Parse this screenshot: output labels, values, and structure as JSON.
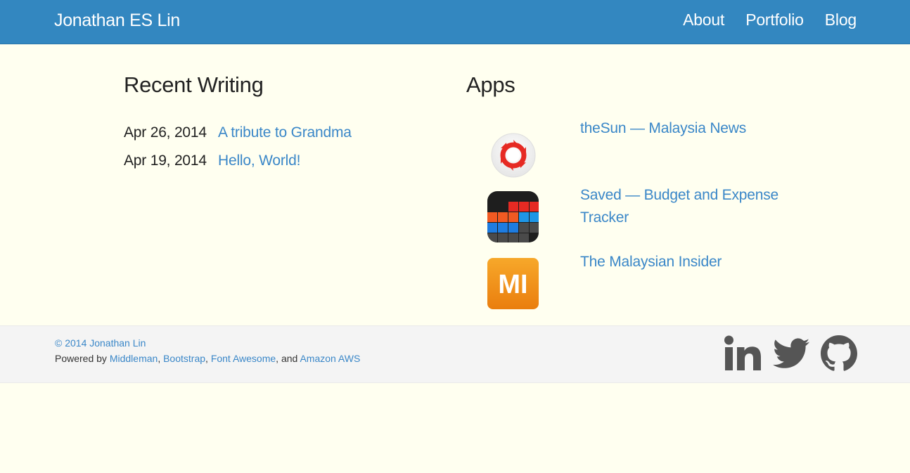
{
  "navbar": {
    "brand": "Jonathan ES Lin",
    "links": [
      {
        "label": "About"
      },
      {
        "label": "Portfolio"
      },
      {
        "label": "Blog"
      }
    ]
  },
  "writing": {
    "heading": "Recent Writing",
    "posts": [
      {
        "date": "Apr 26, 2014",
        "title": "A tribute to Grandma"
      },
      {
        "date": "Apr 19, 2014",
        "title": "Hello, World!"
      }
    ]
  },
  "apps": {
    "heading": "Apps",
    "items": [
      {
        "name": "theSun — Malaysia News",
        "icon": "thesun-icon"
      },
      {
        "name": "Saved — Budget and Expense Tracker",
        "icon": "saved-app-icon"
      },
      {
        "name": "The Malaysian Insider",
        "icon": "malaysian-insider-icon",
        "icon_text": "MI"
      }
    ]
  },
  "footer": {
    "copyright": "© 2014 Jonathan Lin",
    "powered_prefix": "Powered by ",
    "tools": [
      "Middleman",
      "Bootstrap",
      "Font Awesome",
      "Amazon AWS"
    ],
    "sep1": ", ",
    "sep2": ", ",
    "sep3": ", and ",
    "social": [
      "linkedin-icon",
      "twitter-icon",
      "github-icon"
    ]
  },
  "colors": {
    "navbar": "#3387c0",
    "background": "#fffff0",
    "link": "#3a87c8",
    "footer": "#f4f4f4",
    "social_icon": "#555555"
  }
}
